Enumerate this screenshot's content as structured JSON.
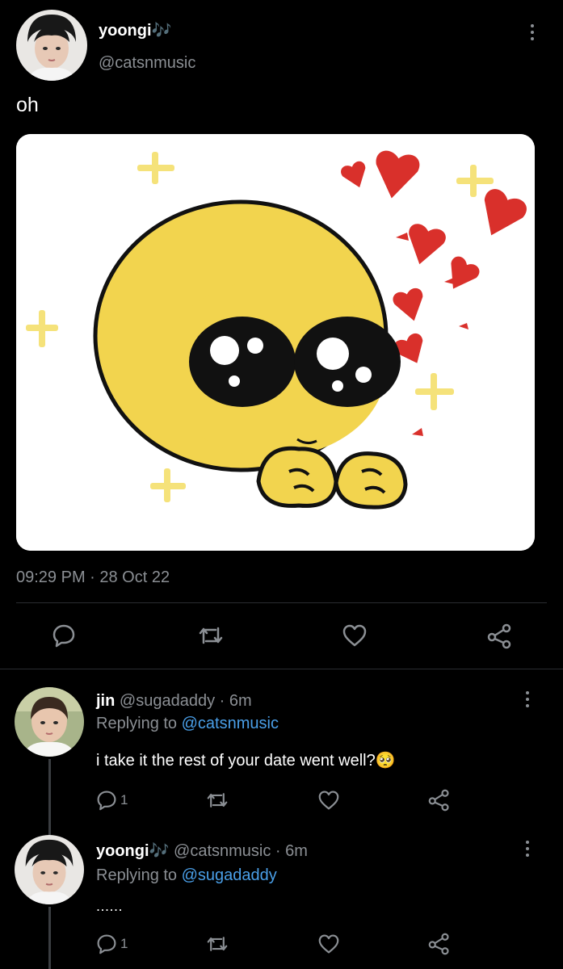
{
  "main_tweet": {
    "display_name": "yoongi🎶",
    "handle": "@catsnmusic",
    "text": "oh",
    "timestamp": "09:29 PM · 28 Oct 22",
    "actions": [
      "reply-icon",
      "retweet-icon",
      "like-icon",
      "share-icon"
    ]
  },
  "replies": [
    {
      "display_name": "jin",
      "handle": "@sugadaddy",
      "time": "· 6m",
      "replying_prefix": "Replying to",
      "replying_to": "@catsnmusic",
      "text": "i take it the rest of your date went well?🥺",
      "reply_count": "1"
    },
    {
      "display_name": "yoongi🎶",
      "handle": "@catsnmusic",
      "time": "· 6m",
      "replying_prefix": "Replying to",
      "replying_to": "@sugadaddy",
      "text": "......",
      "reply_count": "1"
    }
  ],
  "colors": {
    "background": "#000000",
    "link": "#4a9fe8",
    "muted": "#8b8f94",
    "heart": "#d9302b",
    "emoji_face": "#f2d44e"
  }
}
